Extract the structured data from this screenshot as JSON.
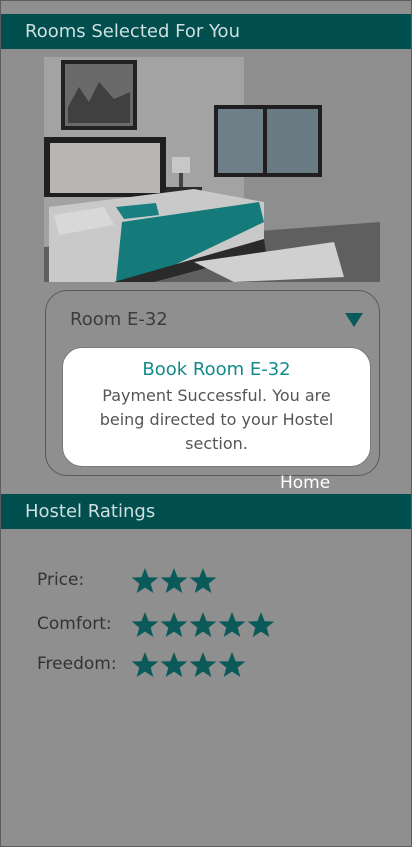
{
  "rooms_section": {
    "title": "Rooms Selected For You"
  },
  "room_select": {
    "selected": "Room E-32",
    "icon": "caret-down-icon"
  },
  "dialog": {
    "title": "Book Room E-32",
    "message": "Payment Successful. You are being directed to your Hostel section."
  },
  "nav": {
    "home_label": "Home"
  },
  "ratings_section": {
    "title": "Hostel Ratings",
    "ratings": [
      {
        "label": "Price:",
        "stars": 3
      },
      {
        "label": "Comfort:",
        "stars": 5
      },
      {
        "label": "Freedom:",
        "stars": 4
      }
    ]
  },
  "colors": {
    "header_bg": "#004e4e",
    "accent": "#148a8a",
    "star": "#0b5a5a",
    "overlay_bg": "#8f8f8f"
  }
}
